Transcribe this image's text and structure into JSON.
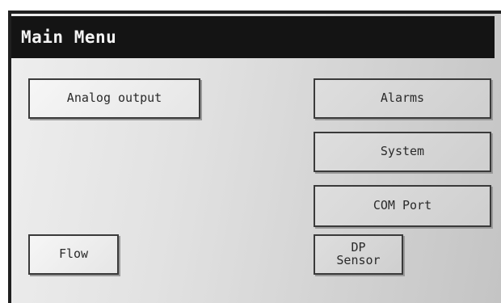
{
  "header": {
    "title": "Main Menu"
  },
  "buttons": {
    "analog_output": "Analog output",
    "alarms": "Alarms",
    "system": "System",
    "com_port": "COM Port",
    "flow": "Flow",
    "dp_sensor": "DP\nSensor"
  }
}
